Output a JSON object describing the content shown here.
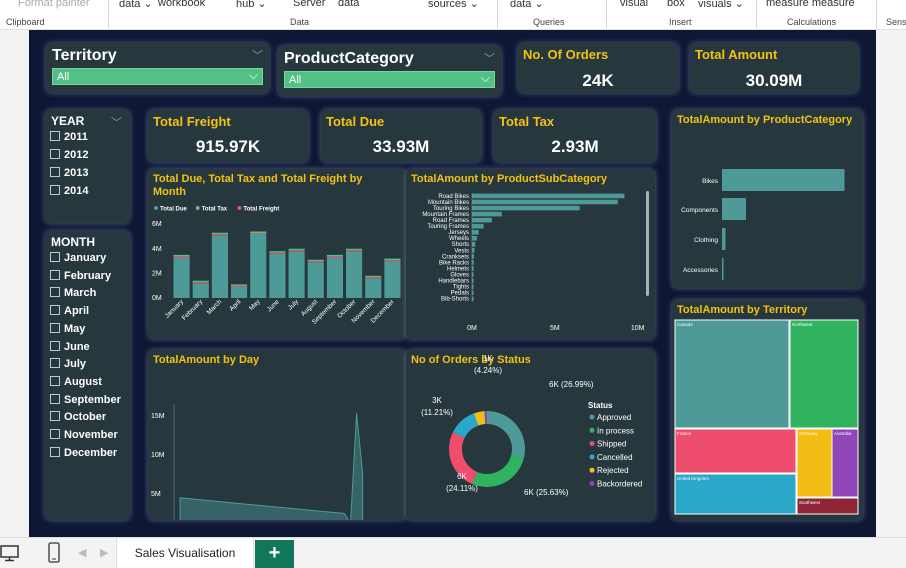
{
  "ribbon": {
    "items": [
      "Format painter",
      "data",
      "workbook",
      "hub",
      "Server",
      "data",
      "sources",
      "data",
      "visual",
      "box",
      "visuals",
      "measure measure"
    ],
    "groups": [
      "Clipboard",
      "Data",
      "Queries",
      "Insert",
      "Calculations",
      "Sens"
    ]
  },
  "slicers": {
    "territory": {
      "title": "Territory",
      "value": "All"
    },
    "product_category": {
      "title": "ProductCategory",
      "value": "All"
    },
    "year": {
      "title": "YEAR",
      "items": [
        "2011",
        "2012",
        "2013",
        "2014"
      ]
    },
    "month": {
      "title": "MONTH",
      "items": [
        "January",
        "February",
        "March",
        "April",
        "May",
        "June",
        "July",
        "August",
        "September",
        "October",
        "November",
        "December"
      ]
    }
  },
  "kpis": {
    "orders": {
      "label": "No. Of Orders",
      "value": "24K"
    },
    "total_amount": {
      "label": "Total Amount",
      "value": "30.09M"
    },
    "freight": {
      "label": "Total Freight",
      "value": "915.97K"
    },
    "due": {
      "label": "Total Due",
      "value": "33.93M"
    },
    "tax": {
      "label": "Total Tax",
      "value": "2.93M"
    }
  },
  "colors": {
    "accent": "#f3c313",
    "teal": "#4e9a99",
    "green": "#53c184",
    "bg": "#0e1733",
    "card": "#26373d"
  },
  "tabs": {
    "active": "Sales Visualisation",
    "add": "+"
  },
  "chart_data": [
    {
      "type": "bar",
      "title": "Total Due, Total Tax and Total Freight by Month",
      "legend": [
        "Total Due",
        "Total Tax",
        "Total Freight"
      ],
      "categories": [
        "January",
        "February",
        "March",
        "April",
        "May",
        "June",
        "July",
        "August",
        "September",
        "October",
        "November",
        "December"
      ],
      "series": [
        {
          "name": "Total Due",
          "values": [
            3.3,
            1.2,
            5.1,
            0.9,
            5.2,
            3.6,
            3.8,
            2.9,
            3.3,
            3.8,
            1.6,
            3.0
          ]
        }
      ],
      "yticks": [
        "0M",
        "2M",
        "4M",
        "6M"
      ],
      "ylim": [
        0,
        6.5
      ]
    },
    {
      "type": "bar",
      "title": "TotalAmount by ProductSubCategory",
      "categories": [
        "Road Bikes",
        "Mountain Bikes",
        "Touring Bikes",
        "Mountain Frames",
        "Road Frames",
        "Touring Frames",
        "Jerseys",
        "Wheels",
        "Shorts",
        "Vests",
        "Cranksets",
        "Bike Racks",
        "Helmets",
        "Gloves",
        "Handlebars",
        "Tights",
        "Pedals",
        "Bib-Shorts"
      ],
      "values": [
        9.2,
        8.8,
        6.5,
        1.8,
        1.2,
        0.7,
        0.4,
        0.3,
        0.2,
        0.15,
        0.12,
        0.1,
        0.1,
        0.08,
        0.06,
        0.05,
        0.05,
        0.03
      ],
      "xticks": [
        "0M",
        "5M",
        "10M"
      ],
      "xlim": [
        0,
        10.2
      ]
    },
    {
      "type": "bar",
      "title": "TotalAmount by ProductCategory",
      "categories": [
        "Bikes",
        "Components",
        "Clothing",
        "Accessories"
      ],
      "values": [
        24.5,
        4.8,
        0.7,
        0.2
      ],
      "xticks": [
        "0M",
        "10M",
        "20M"
      ],
      "xlim": [
        0,
        26
      ]
    },
    {
      "type": "area",
      "title": "TotalAmount by Day",
      "x": [
        1,
        28,
        29,
        30,
        31
      ],
      "y": [
        4.5,
        2.5,
        1.2,
        15.3,
        7.6
      ],
      "xticks": [
        "0",
        "5",
        "10",
        "15",
        "20",
        "25",
        "30",
        "35"
      ],
      "yticks": [
        "0M",
        "5M",
        "10M",
        "15M"
      ],
      "xlim": [
        0,
        35
      ],
      "ylim": [
        0,
        16
      ]
    },
    {
      "type": "pie",
      "title": "No of Orders by Status",
      "legend_title": "Status",
      "categories": [
        "Approved",
        "In process",
        "Shipped",
        "Cancelled",
        "Rejected",
        "Backordered"
      ],
      "values": [
        26.99,
        25.63,
        24.11,
        11.21,
        4.24,
        1.0
      ],
      "labels": [
        "6K (26.99%)",
        "6K (25.63%)",
        "6K (24.11%)",
        "3K (11.21%)",
        "1K (4.24%)",
        ""
      ],
      "colors": [
        "#4e9a99",
        "#2fb35f",
        "#ee4d6e",
        "#2aa8c9",
        "#f2bd15",
        "#8e46b8"
      ]
    },
    {
      "type": "treemap",
      "title": "TotalAmount by Territory",
      "categories": [
        "Canada",
        "Northwest",
        "France",
        "Germany",
        "Australia",
        "United Kingdom",
        "Southwest"
      ],
      "colors": [
        "#4e9a99",
        "#2fb35f",
        "#ee4d6e",
        "#f2bd15",
        "#8e46b8",
        "#2aa8c9",
        "#8e2436"
      ]
    }
  ]
}
